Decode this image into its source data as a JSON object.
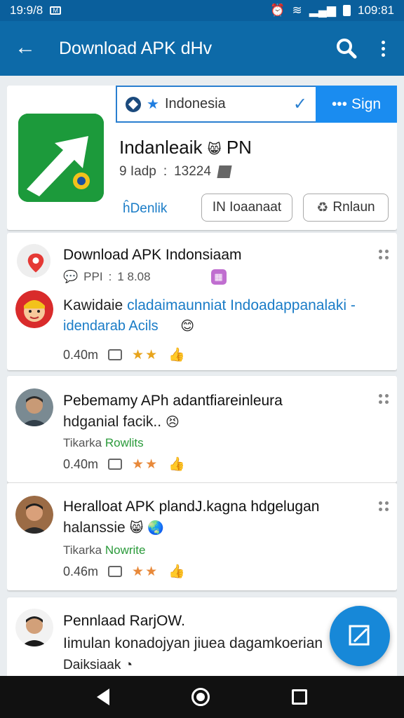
{
  "status_bar": {
    "time_left": "19:9/8",
    "time_right": "109:81"
  },
  "app_bar": {
    "title": "Download APK dHv",
    "icons": [
      "back-arrow-icon",
      "search-icon",
      "more-vert-icon"
    ]
  },
  "app_card": {
    "country": "Indonesia",
    "signin_label": "Sign",
    "app_name": "Indanleaik",
    "app_name_suffix": "PN",
    "meta_left": "9 Iadp",
    "meta_right": "13224",
    "link_label": "ĥDenlik",
    "install_label": "IN Ioaanaat",
    "restore_label": "Rnlaun"
  },
  "posts": [
    {
      "title": "Download APK Indonsiaam",
      "meta_left": "PPI",
      "meta_right": "1 8.08",
      "sub_title_dark": "Kawidaie",
      "sub_title_link": "cladaimaunniat Indoadappanalaki",
      "sub_line2": "idendarab Acils",
      "time": "0.40m",
      "stars": "★★"
    },
    {
      "title": "Pebemamy APh adantfiareinleura",
      "sub": "hdganial facik..",
      "source_left": "Tikarka",
      "source_right": "Rowlits",
      "time": "0.40m",
      "stars": "★★"
    },
    {
      "title": "Heralloat APK plandJ.kagna hdgelugan",
      "sub": "halanssie",
      "source_left": "Tikarka",
      "source_right": "Nowrite",
      "time": "0.46m",
      "stars": "★★"
    },
    {
      "title": "Pennlaad RarjOW.",
      "sub": "Iimulan konadojyan jiuea dagamkoerian",
      "source_left": "Daiksiaak"
    }
  ],
  "colors": {
    "app_bar": "#0d6aa8",
    "status_bar": "#0a5f9c",
    "accent": "#1a8cf0",
    "fab": "#1788d8",
    "star": "#e8a41c",
    "link": "#1a7cc7"
  }
}
